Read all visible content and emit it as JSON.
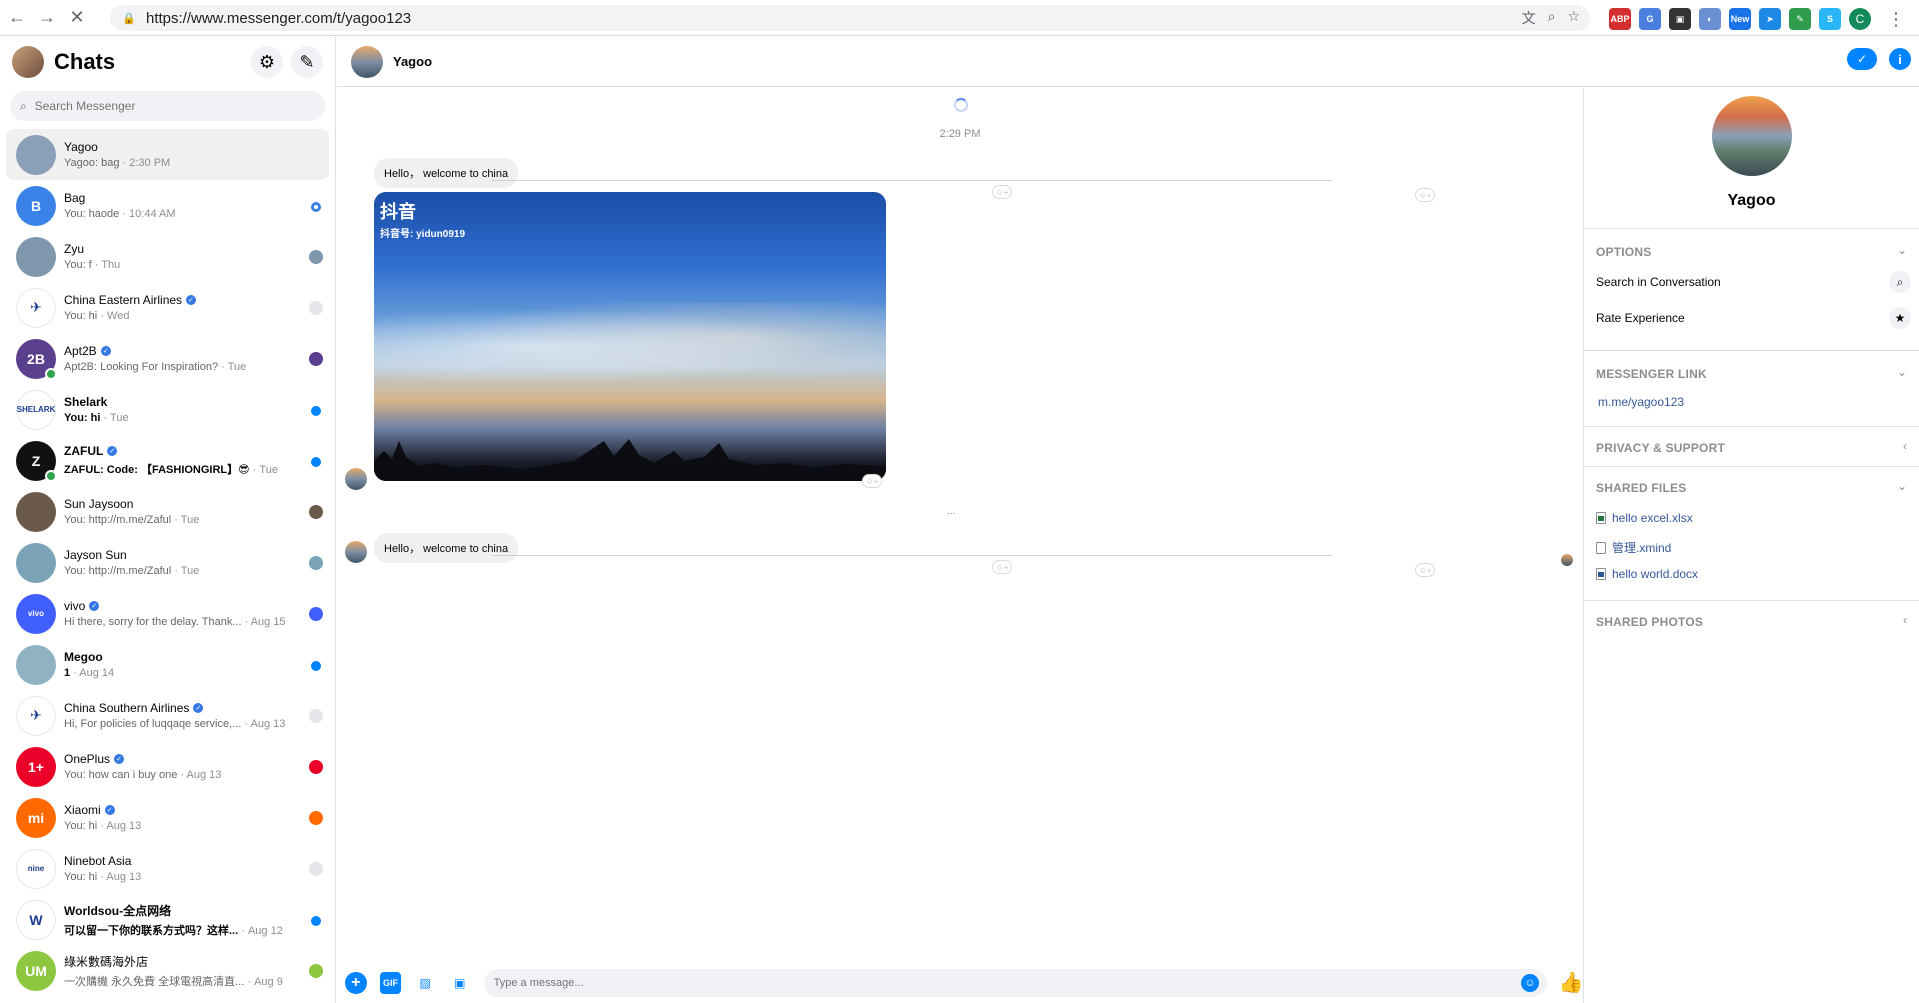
{
  "browser": {
    "url": "https://www.messenger.com/t/yagoo123",
    "extensions": [
      "ABP",
      "translate",
      "ext",
      "ext",
      "ext",
      "New",
      "ext",
      "ext",
      "S"
    ],
    "profile_initial": "C"
  },
  "sidebar": {
    "title": "Chats",
    "search_placeholder": "Search Messenger",
    "conversations": [
      {
        "name": "Yagoo",
        "snippet": "Yagoo: bag",
        "time": "2:30 PM",
        "unread": false,
        "active": true,
        "verified": false,
        "avatar_color": "#8aa0b8",
        "avatar_text": ""
      },
      {
        "name": "Bag",
        "snippet": "You: haode",
        "time": "10:44 AM",
        "unread": false,
        "verified": false,
        "avatar_color": "#3b82e8",
        "avatar_text": "B"
      },
      {
        "name": "Zyu",
        "snippet": "You: f",
        "time": "Thu",
        "unread": false,
        "verified": false,
        "avatar_color": "#7f97ad",
        "avatar_text": ""
      },
      {
        "name": "China Eastern Airlines",
        "snippet": "You: hi",
        "time": "Wed",
        "unread": false,
        "verified": true,
        "avatar_color": "#ffffff",
        "avatar_text": "✈"
      },
      {
        "name": "Apt2B",
        "snippet": "Apt2B: Looking For Inspiration?",
        "time": "Tue",
        "unread": false,
        "verified": true,
        "avatar_color": "#5b3f8f",
        "avatar_text": "2B"
      },
      {
        "name": "Shelark",
        "snippet": "You: hi",
        "time": "Tue",
        "unread": true,
        "verified": false,
        "avatar_color": "#ffffff",
        "avatar_text": "SHELARK"
      },
      {
        "name": "ZAFUL",
        "snippet": "ZAFUL: Code: 【FASHIONGIRL】😎",
        "time": "Tue",
        "unread": true,
        "verified": true,
        "avatar_color": "#111111",
        "avatar_text": "Z"
      },
      {
        "name": "Sun Jaysoon",
        "snippet": "You: http://m.me/Zaful",
        "time": "Tue",
        "unread": false,
        "verified": false,
        "avatar_color": "#6b5a4a",
        "avatar_text": ""
      },
      {
        "name": "Jayson Sun",
        "snippet": "You: http://m.me/Zaful",
        "time": "Tue",
        "unread": false,
        "verified": false,
        "avatar_color": "#7aa3b8",
        "avatar_text": ""
      },
      {
        "name": "vivo",
        "snippet": "Hi there, sorry for the delay. Thank...",
        "time": "Aug 15",
        "unread": false,
        "verified": true,
        "avatar_color": "#415fff",
        "avatar_text": "vivo"
      },
      {
        "name": "Megoo",
        "snippet": "1",
        "time": "Aug 14",
        "unread": true,
        "verified": false,
        "avatar_color": "#8fb3c2",
        "avatar_text": ""
      },
      {
        "name": "China Southern Airlines",
        "snippet": "Hi, For policies of luqqaqe service,...",
        "time": "Aug 13",
        "unread": false,
        "verified": true,
        "avatar_color": "#ffffff",
        "avatar_text": "✈"
      },
      {
        "name": "OnePlus",
        "snippet": "You: how can i buy one",
        "time": "Aug 13",
        "unread": false,
        "verified": true,
        "avatar_color": "#eb0029",
        "avatar_text": "1+"
      },
      {
        "name": "Xiaomi",
        "snippet": "You: hi",
        "time": "Aug 13",
        "unread": false,
        "verified": true,
        "avatar_color": "#ff6900",
        "avatar_text": "mi"
      },
      {
        "name": "Ninebot Asia",
        "snippet": "You: hi",
        "time": "Aug 13",
        "unread": false,
        "verified": false,
        "avatar_color": "#ffffff",
        "avatar_text": "nine"
      },
      {
        "name": "Worldsou-全点网络",
        "snippet": "可以留一下你的联系方式吗？这样...",
        "time": "Aug 12",
        "unread": true,
        "verified": false,
        "avatar_color": "#ffffff",
        "avatar_text": "W"
      },
      {
        "name": "綠米數碼海外店",
        "snippet": "一次購機 永久免費 全球電視高清直...",
        "time": "Aug 9",
        "unread": false,
        "verified": false,
        "avatar_color": "#8dc63f",
        "avatar_text": "UM"
      }
    ]
  },
  "chat": {
    "name": "Yagoo",
    "timestamp": "2:29 PM",
    "messages": [
      {
        "text": "Hello， welcome to china"
      },
      {
        "text": "Hello， welcome to china"
      }
    ],
    "video": {
      "brand": "抖音",
      "account": "抖音号: yidun0919"
    },
    "composer_placeholder": "Type a message..."
  },
  "info_panel": {
    "name": "Yagoo",
    "options_title": "Options",
    "options": [
      "Search in Conversation",
      "Rate Experience"
    ],
    "messenger_link_title": "Messenger Link",
    "messenger_link": "m.me/yagoo123",
    "privacy_title": "Privacy & Support",
    "shared_files_title": "Shared Files",
    "shared_files": [
      {
        "name": "hello excel.xlsx",
        "type": "x"
      },
      {
        "name": "管理.xmind",
        "type": ""
      },
      {
        "name": "hello world.docx",
        "type": "w"
      }
    ],
    "shared_photos_title": "Shared Photos"
  }
}
